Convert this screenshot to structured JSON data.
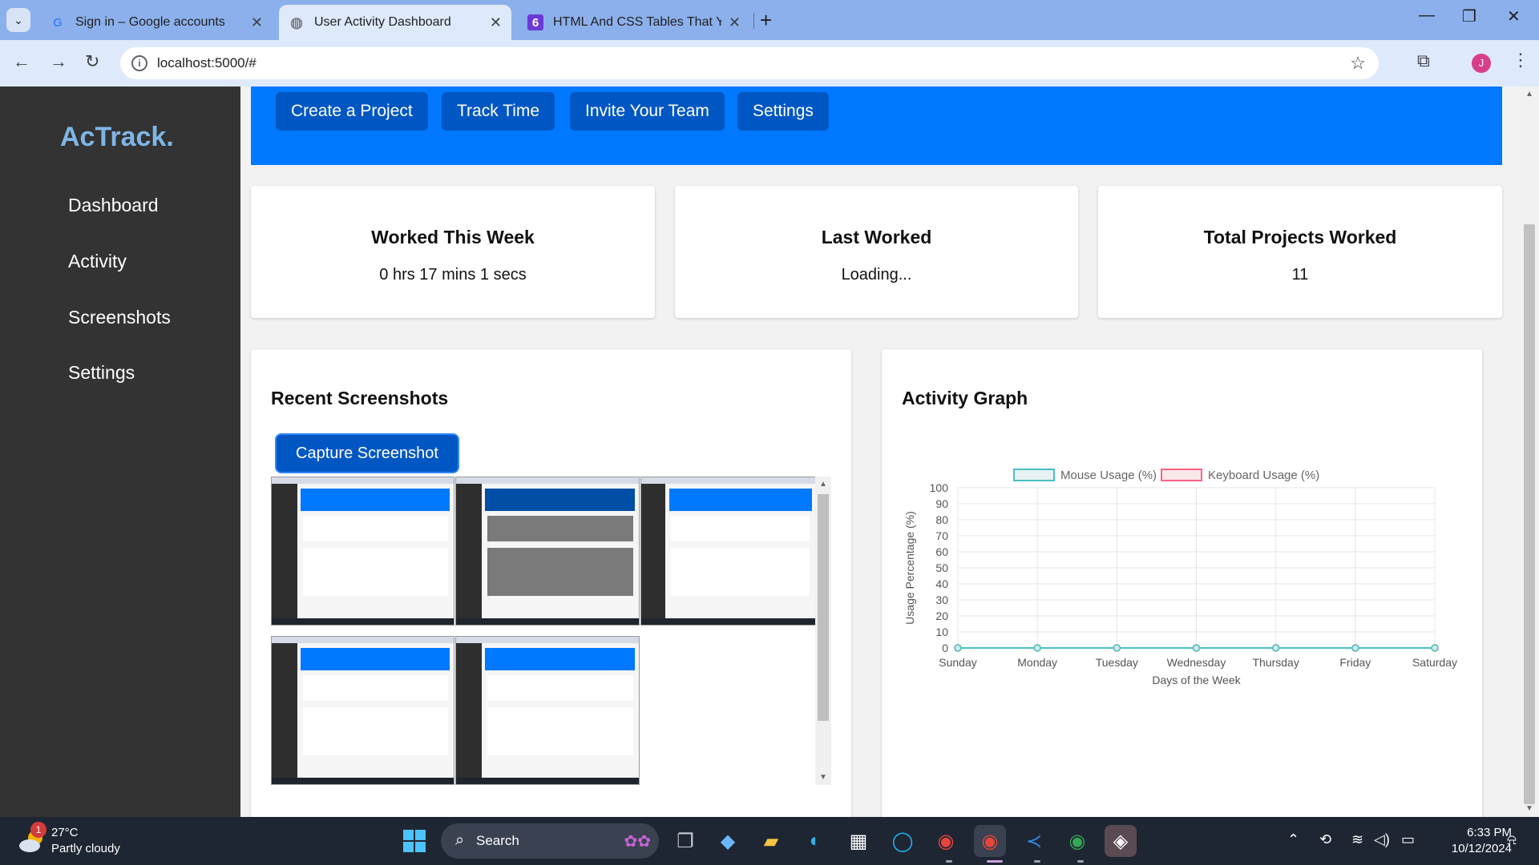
{
  "browser": {
    "tabs": [
      {
        "title": "Sign in – Google accounts",
        "favicon": "G"
      },
      {
        "title": "User Activity Dashboard",
        "favicon": "globe-icon"
      },
      {
        "title": "HTML And CSS Tables That You",
        "favicon": "6"
      }
    ],
    "url": "localhost:5000/#",
    "profile_initial": "J"
  },
  "sidebar": {
    "brand": "AcTrack.",
    "items": [
      {
        "label": "Dashboard"
      },
      {
        "label": "Activity"
      },
      {
        "label": "Screenshots"
      },
      {
        "label": "Settings"
      }
    ]
  },
  "header": {
    "buttons": [
      {
        "label": "Create a Project"
      },
      {
        "label": "Track Time"
      },
      {
        "label": "Invite Your Team"
      },
      {
        "label": "Settings"
      }
    ]
  },
  "stats": [
    {
      "title": "Worked This Week",
      "value": "0 hrs 17 mins 1 secs"
    },
    {
      "title": "Last Worked",
      "value": "Loading..."
    },
    {
      "title": "Total Projects Worked",
      "value": "11"
    }
  ],
  "screenshots": {
    "title": "Recent Screenshots",
    "capture_label": "Capture Screenshot"
  },
  "activity": {
    "title": "Activity Graph"
  },
  "chart_data": {
    "type": "line",
    "x": [
      "Sunday",
      "Monday",
      "Tuesday",
      "Wednesday",
      "Thursday",
      "Friday",
      "Saturday"
    ],
    "series": [
      {
        "name": "Mouse Usage (%)",
        "values": [
          0,
          0,
          0,
          0,
          0,
          0,
          0
        ],
        "color": "#4bc0c0"
      },
      {
        "name": "Keyboard Usage (%)",
        "values": [
          0,
          0,
          0,
          0,
          0,
          0,
          0
        ],
        "color": "#ff6384"
      }
    ],
    "yticks": [
      "100",
      "90",
      "80",
      "70",
      "60",
      "50",
      "40",
      "30",
      "20",
      "10",
      "0"
    ],
    "ylim": [
      0,
      100
    ],
    "xlabel": "Days of the Week",
    "ylabel": "Usage Percentage (%)",
    "legend": "top",
    "grid": true
  },
  "taskbar": {
    "weather_temp": "27°C",
    "weather_desc": "Partly cloudy",
    "weather_badge": "1",
    "search_label": "Search",
    "time": "6:33 PM",
    "date": "10/12/2024"
  }
}
